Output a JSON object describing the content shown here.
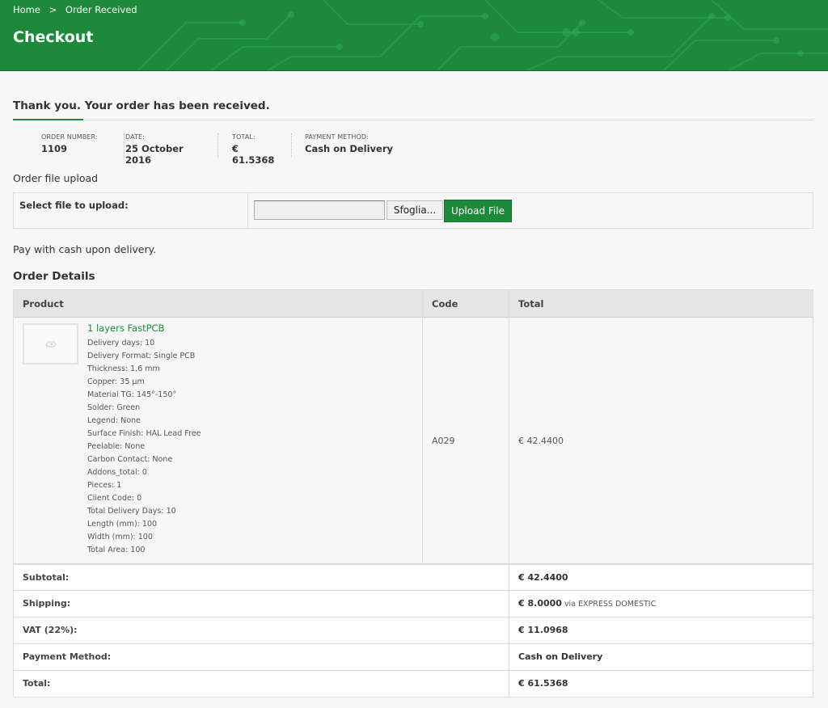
{
  "breadcrumb": {
    "home": "Home",
    "separator": ">",
    "current": "Order Received"
  },
  "page_title": "Checkout",
  "thank_you": "Thank you. Your order has been received.",
  "overview": [
    {
      "label": "Order Number:",
      "value": "1109"
    },
    {
      "label": "Date:",
      "value": "25 October 2016"
    },
    {
      "label": "Total:",
      "value": "€ 61.5368"
    },
    {
      "label": "Payment Method:",
      "value": "Cash on Delivery"
    }
  ],
  "upload": {
    "section_title": "Order file upload",
    "label": "Select file to upload:",
    "file_value": "",
    "browse_label": "Sfoglia...",
    "submit_label": "Upload File"
  },
  "pay_note": "Pay with cash upon delivery.",
  "order_details": {
    "title": "Order Details",
    "headers": {
      "product": "Product",
      "code": "Code",
      "total": "Total"
    },
    "item": {
      "name": "1 layers FastPCB",
      "thumbnail_icon": "placeholder-image-icon",
      "meta": [
        "Delivery days: 10",
        "Delivery Format: Single PCB",
        "Thickness: 1,6 mm",
        "Copper: 35 μm",
        "Material TG: 145°-150°",
        "Solder: Green",
        "Legend: None",
        "Surface Finish: HAL Lead Free",
        "Peelable: None",
        "Carbon Contact: None",
        "Addons_total: 0",
        "Pieces: 1",
        "Client Code: 0",
        "Total Delivery Days: 10",
        "Length (mm): 100",
        "Width (mm): 100",
        "Total Area: 100"
      ],
      "code": "A029",
      "total": "€ 42.4400"
    },
    "totals": [
      {
        "label": "Subtotal:",
        "value": "€ 42.4400",
        "note": ""
      },
      {
        "label": "Shipping:",
        "value": "€ 8.0000",
        "note": "via EXPRESS DOMESTIC"
      },
      {
        "label": "VAT (22%):",
        "value": "€ 11.0968",
        "note": ""
      },
      {
        "label": "Payment Method:",
        "value": "Cash on Delivery",
        "note": ""
      },
      {
        "label": "Total:",
        "value": "€ 61.5368",
        "note": ""
      }
    ]
  },
  "colors": {
    "brand": "#1d8a3b",
    "background": "#f7f7f7",
    "border": "#dcdcdc"
  }
}
